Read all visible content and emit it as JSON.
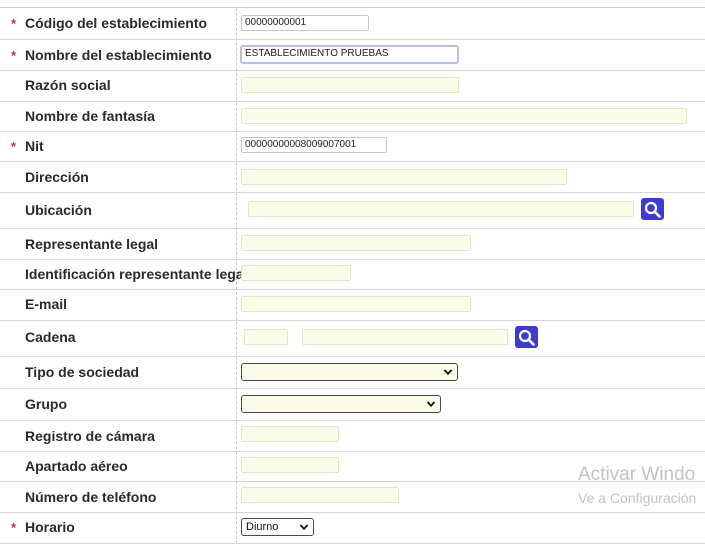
{
  "form": {
    "codigo": {
      "label": "Código del establecimiento",
      "required": true,
      "value": "00000000001"
    },
    "nombre": {
      "label": "Nombre del establecimiento",
      "required": true,
      "value": "ESTABLECIMIENTO PRUEBAS"
    },
    "razon": {
      "label": "Razón social",
      "required": false,
      "value": ""
    },
    "fantasia": {
      "label": "Nombre de fantasía",
      "required": false,
      "value": ""
    },
    "nit": {
      "label": "Nit",
      "required": true,
      "value": "00000000008009007001"
    },
    "direccion": {
      "label": "Dirección",
      "required": false,
      "value": ""
    },
    "ubicacion": {
      "label": "Ubicación",
      "required": false,
      "value": ""
    },
    "representante": {
      "label": "Representante legal",
      "required": false,
      "value": ""
    },
    "identificacion": {
      "label": "Identificación representante legal",
      "required": false,
      "value": ""
    },
    "email": {
      "label": "E-mail",
      "required": false,
      "value": ""
    },
    "cadena": {
      "label": "Cadena",
      "required": false,
      "code": "",
      "value": ""
    },
    "tipo_sociedad": {
      "label": "Tipo de sociedad",
      "required": false,
      "selected": ""
    },
    "grupo": {
      "label": "Grupo",
      "required": false,
      "selected": ""
    },
    "registro": {
      "label": "Registro de cámara",
      "required": false,
      "value": ""
    },
    "apartado": {
      "label": "Apartado aéreo",
      "required": false,
      "value": ""
    },
    "telefono": {
      "label": "Número de teléfono",
      "required": false,
      "value": ""
    },
    "horario": {
      "label": "Horario",
      "required": true,
      "selected": "Diurno"
    }
  },
  "required_mark": "*",
  "watermark": {
    "line1": "Activar Windo",
    "line2": "Ve a Configuración"
  },
  "colors": {
    "required": "#c0392b",
    "field_bg": "#fbfde9",
    "search_button": "#3d3bd1"
  },
  "icons": {
    "search": "search-icon",
    "dropdown": "chevron-down-icon"
  }
}
